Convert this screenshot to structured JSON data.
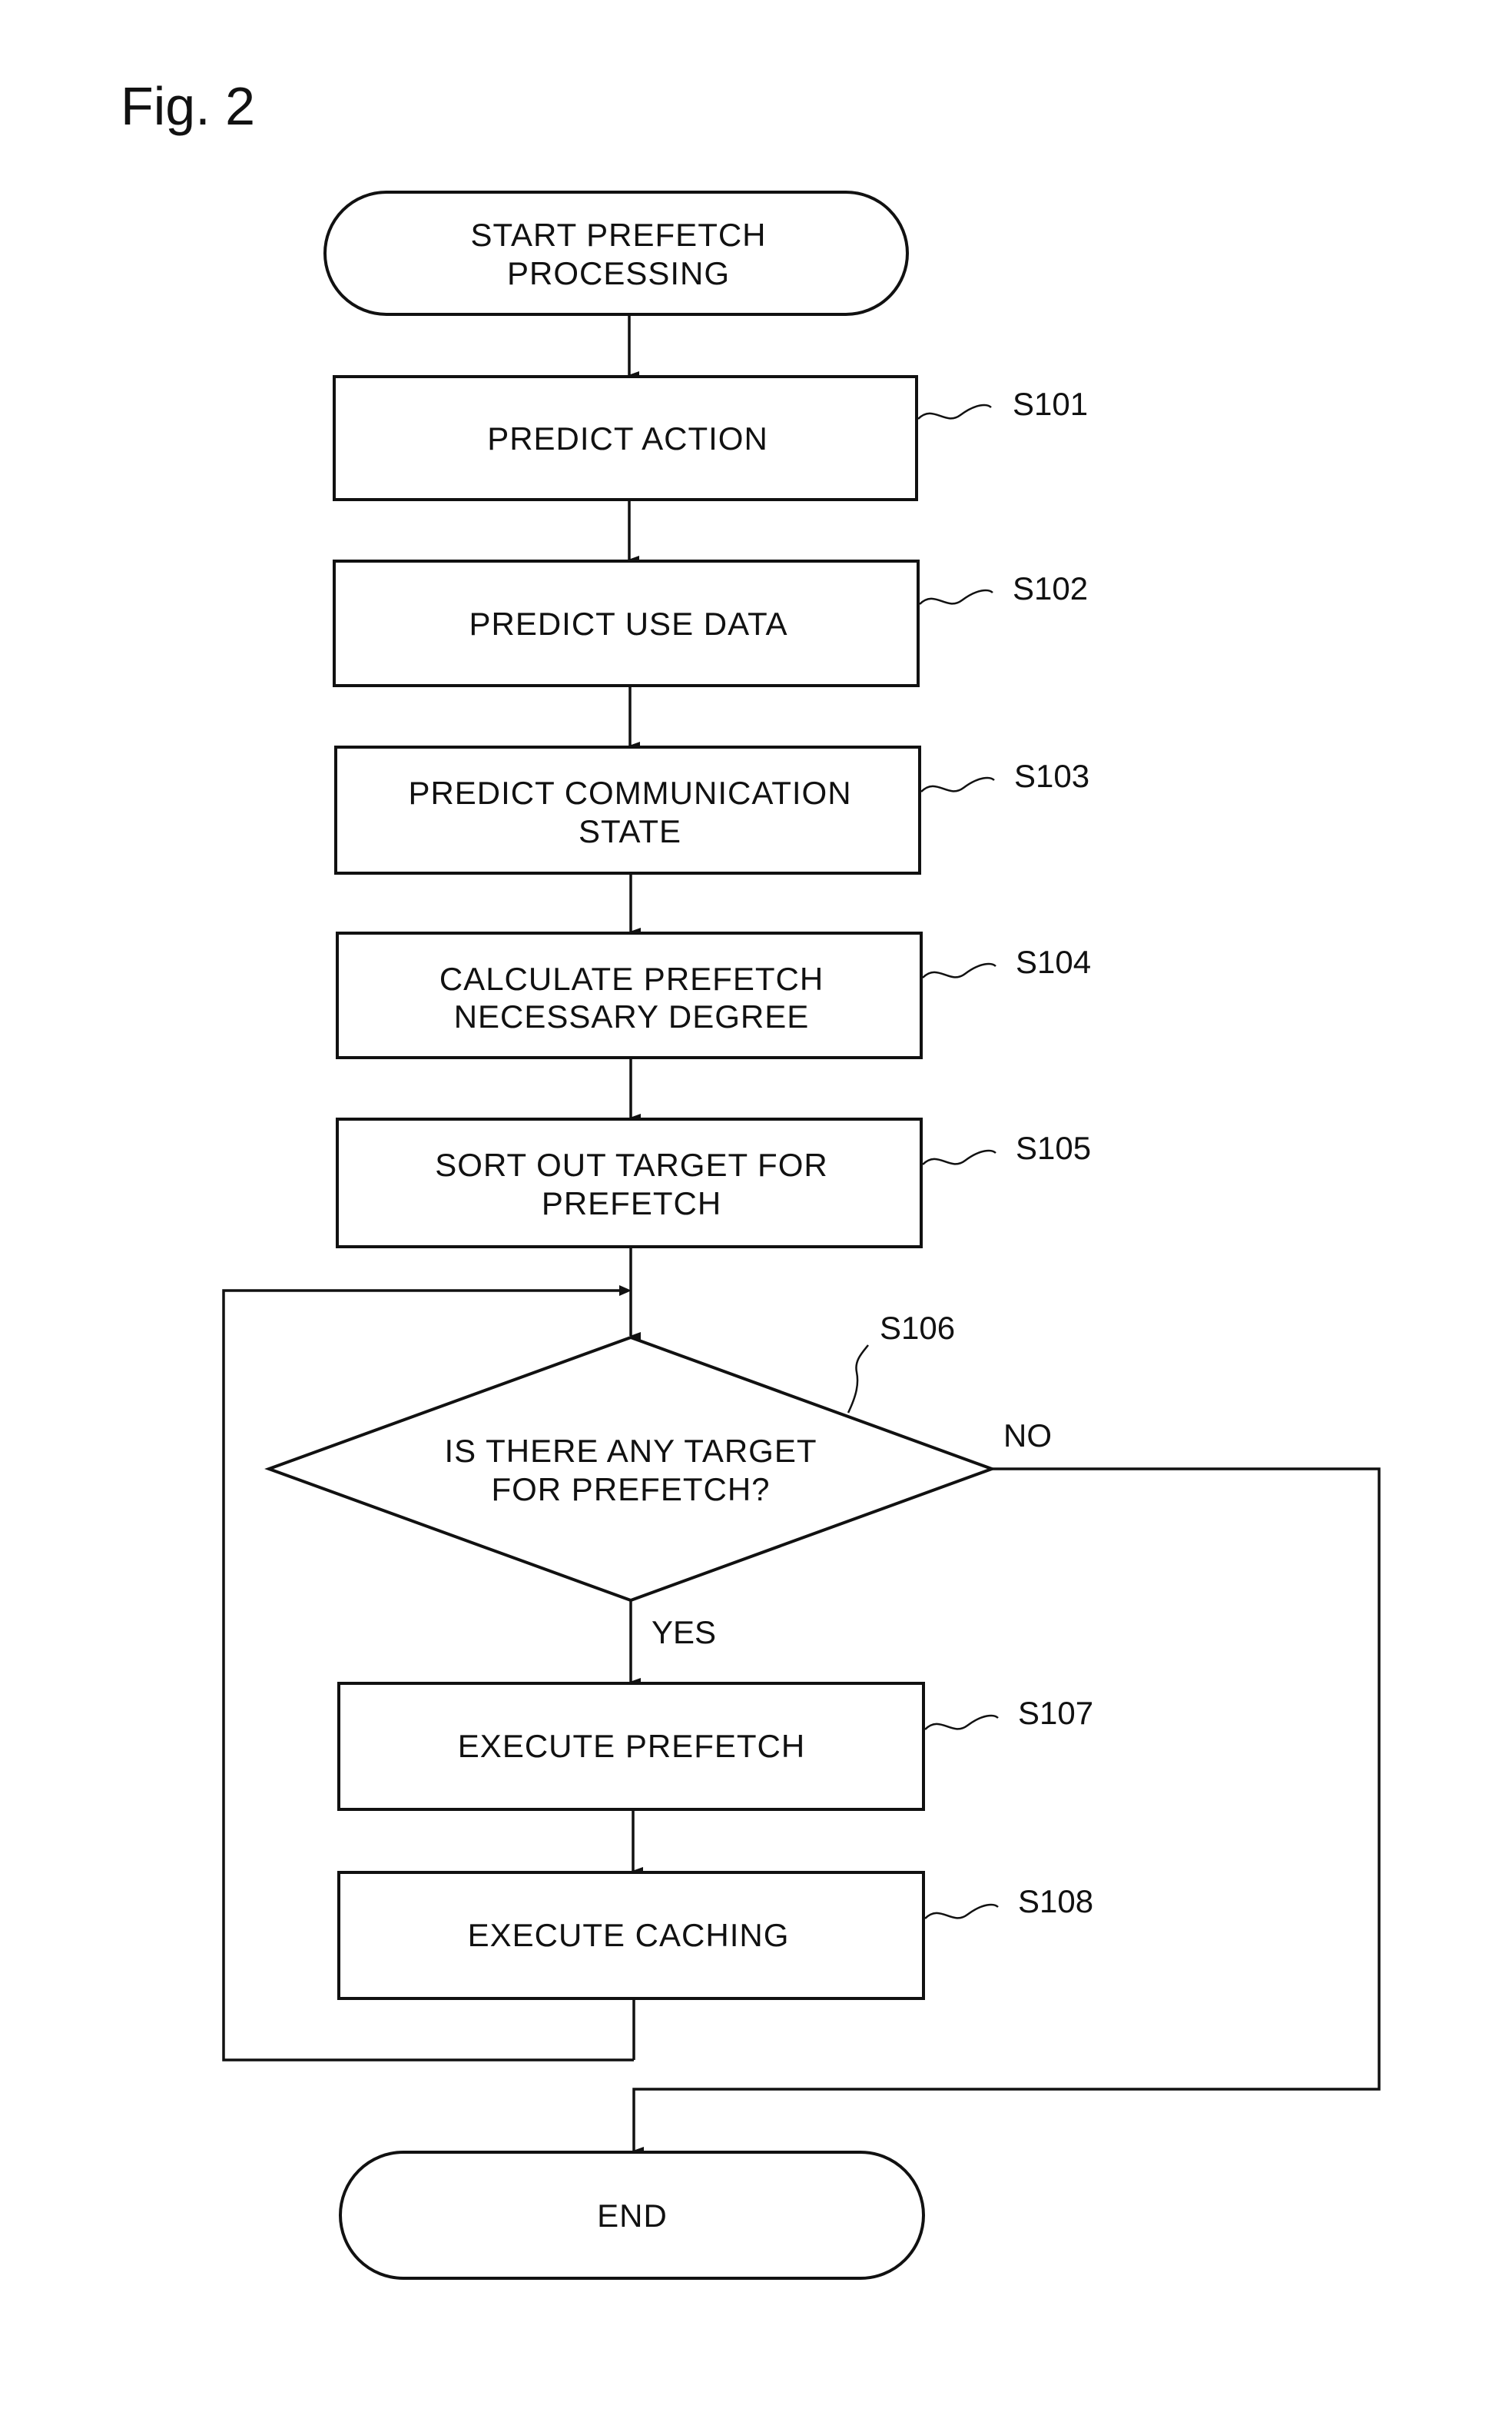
{
  "figure": {
    "title": "Fig. 2"
  },
  "flowchart": {
    "start": {
      "lines": [
        "START PREFETCH",
        "PROCESSING"
      ]
    },
    "steps": [
      {
        "id": "S101",
        "lines": [
          "PREDICT ACTION"
        ]
      },
      {
        "id": "S102",
        "lines": [
          "PREDICT USE DATA"
        ]
      },
      {
        "id": "S103",
        "lines": [
          "PREDICT COMMUNICATION",
          "STATE"
        ]
      },
      {
        "id": "S104",
        "lines": [
          "CALCULATE PREFETCH",
          "NECESSARY DEGREE"
        ]
      },
      {
        "id": "S105",
        "lines": [
          "SORT OUT TARGET FOR",
          "PREFETCH"
        ]
      }
    ],
    "decision": {
      "id": "S106",
      "lines": [
        "IS THERE ANY TARGET",
        "FOR PREFETCH?"
      ],
      "yes_label": "YES",
      "no_label": "NO"
    },
    "loop_steps": [
      {
        "id": "S107",
        "lines": [
          "EXECUTE PREFETCH"
        ]
      },
      {
        "id": "S108",
        "lines": [
          "EXECUTE CACHING"
        ]
      }
    ],
    "end": {
      "lines": [
        "END"
      ]
    }
  }
}
